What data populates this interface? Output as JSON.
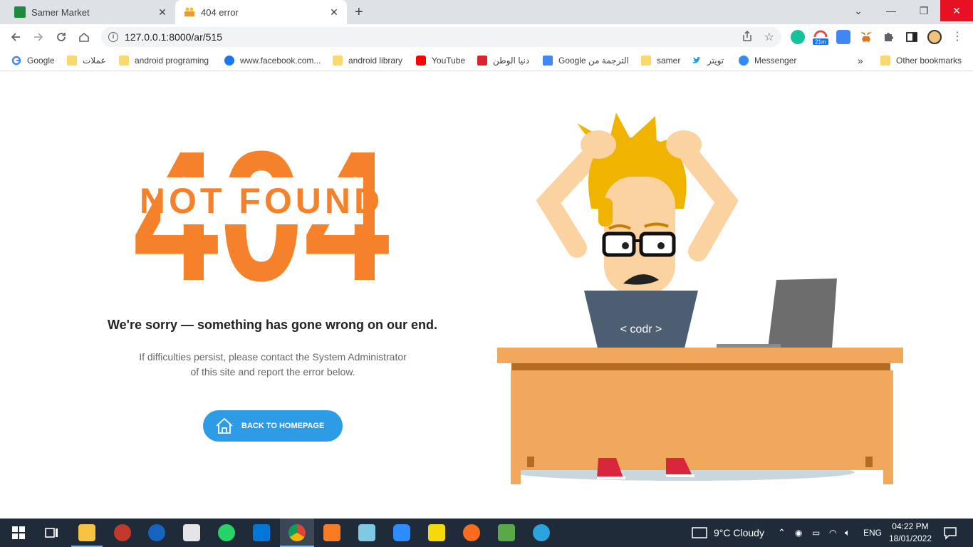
{
  "tabs": [
    {
      "title": "Samer Market",
      "close": "✕"
    },
    {
      "title": "404 error",
      "close": "✕"
    }
  ],
  "new_tab_symbol": "+",
  "window_controls": {
    "minimize": "—",
    "restore": "❐",
    "close": "✕",
    "dropdown": "⌄"
  },
  "address_bar": {
    "url": "127.0.0.1:8000/ar/515",
    "share_icon": "share-icon",
    "bookmark_icon": "star-icon"
  },
  "extensions": {
    "badge_text": "21m"
  },
  "bookmarks": [
    {
      "label": "Google",
      "icon": "google-icon"
    },
    {
      "label": "عملات",
      "icon": "folder-icon"
    },
    {
      "label": "android programing",
      "icon": "folder-icon"
    },
    {
      "label": "www.facebook.com...",
      "icon": "facebook-icon"
    },
    {
      "label": "android library",
      "icon": "folder-icon"
    },
    {
      "label": "YouTube",
      "icon": "youtube-icon"
    },
    {
      "label": "دنيا الوطن",
      "icon": "news-icon"
    },
    {
      "label": "Google الترجمة من",
      "icon": "translate-icon"
    },
    {
      "label": "samer",
      "icon": "folder-icon"
    },
    {
      "label": "تويتر",
      "icon": "twitter-icon"
    },
    {
      "label": "Messenger",
      "icon": "messenger-icon"
    }
  ],
  "bookmarks_overflow": "»",
  "other_bookmarks": "Other bookmarks",
  "page": {
    "big_number": "404",
    "not_found": "NOT FOUND",
    "sorry": "We're sorry — something has gone wrong on our end.",
    "desc_line1": "If difficulties persist, please contact the System Administrator",
    "desc_line2": "of this site and report the error below.",
    "button_label": "BACK TO HOMEPAGE",
    "shirt_text": "< codr >",
    "accent_color": "#f5822a",
    "button_color": "#2d9be6"
  },
  "taskbar": {
    "weather": "9°C  Cloudy",
    "language": "ENG",
    "time": "04:22 PM",
    "date": "18/01/2022"
  }
}
